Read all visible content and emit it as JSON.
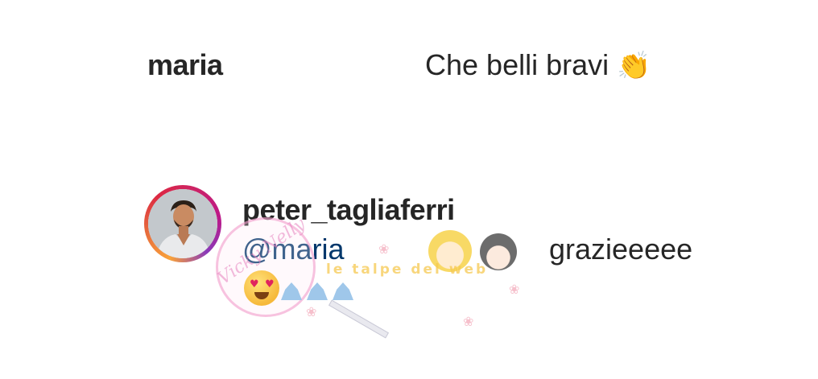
{
  "comments": [
    {
      "username": "maria",
      "text": "Che belli bravi",
      "emoji": "clapping-hands"
    },
    {
      "username": "peter_tagliaferri",
      "mention": "@maria",
      "text": "grazieeeee",
      "emojis": [
        "heart-eyes-face",
        "folded-hands",
        "folded-hands",
        "folded-hands"
      ],
      "avatar_story_ring": true
    }
  ],
  "colors": {
    "text": "#262626",
    "mention": "#00376b",
    "story_ring_start": "#f9a23a",
    "story_ring_end": "#bc1888"
  },
  "watermark": {
    "script_text": "Vicky Nelly",
    "banner_text": "le talpe del web"
  }
}
